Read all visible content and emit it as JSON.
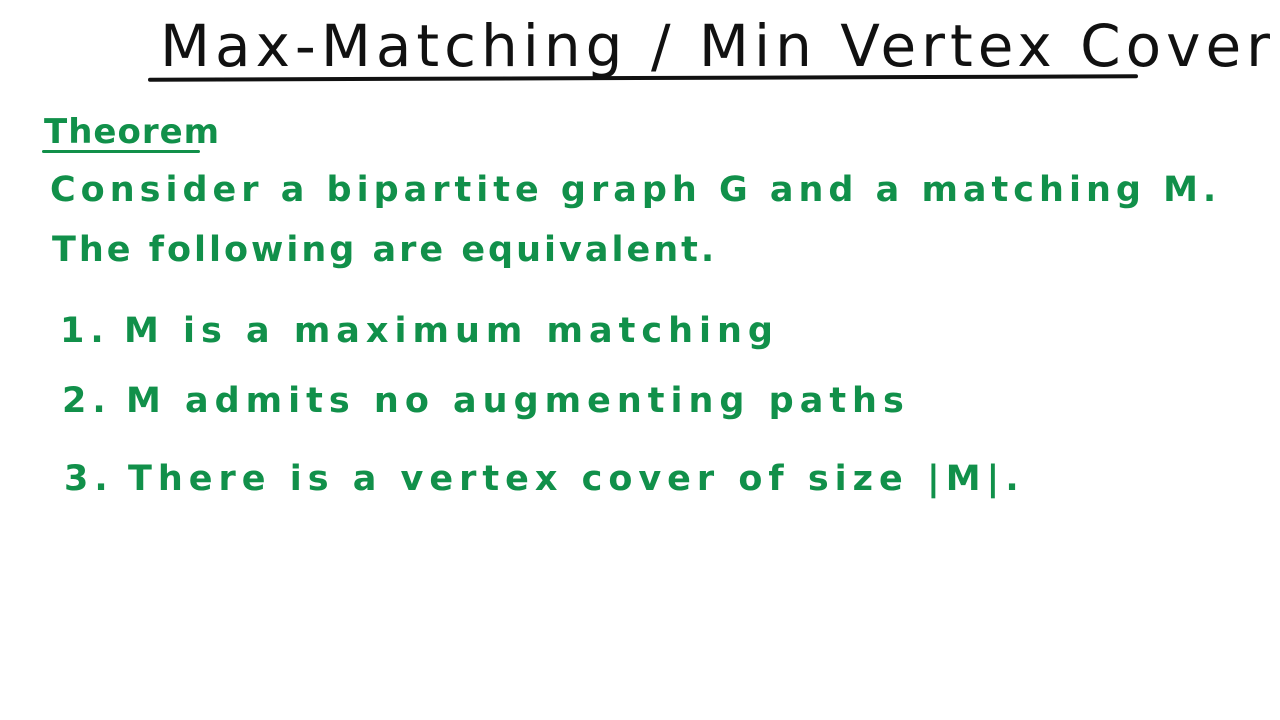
{
  "title": "Max-Matching / Min Vertex Cover",
  "theorem": {
    "heading": "Theorem",
    "statement_line1": "Consider a bipartite graph G and a matching M.",
    "statement_line2": "The following are equivalent."
  },
  "items": [
    {
      "number": "1.",
      "text": "M is a maximum matching"
    },
    {
      "number": "2.",
      "text": "M admits no augmenting paths"
    },
    {
      "number": "3.",
      "text": "There is a vertex cover of size |M|."
    }
  ],
  "colors": {
    "title_ink": "#111111",
    "body_ink": "#11904a",
    "background": "#ffffff"
  }
}
